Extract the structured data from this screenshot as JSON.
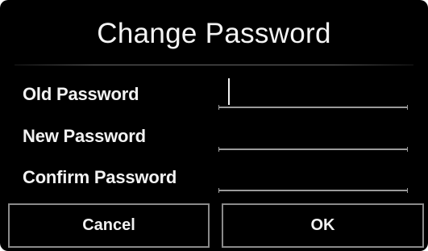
{
  "dialog": {
    "title": "Change Password"
  },
  "fields": [
    {
      "label": "Old Password",
      "value": "",
      "placeholder": ""
    },
    {
      "label": "New Password",
      "value": "",
      "placeholder": ""
    },
    {
      "label": "Confirm Password",
      "value": "",
      "placeholder": ""
    }
  ],
  "buttons": {
    "cancel_label": "Cancel",
    "ok_label": "OK"
  },
  "colors": {
    "background": "#000000",
    "text": "#f2f2f2",
    "border": "#8a8a8a"
  }
}
